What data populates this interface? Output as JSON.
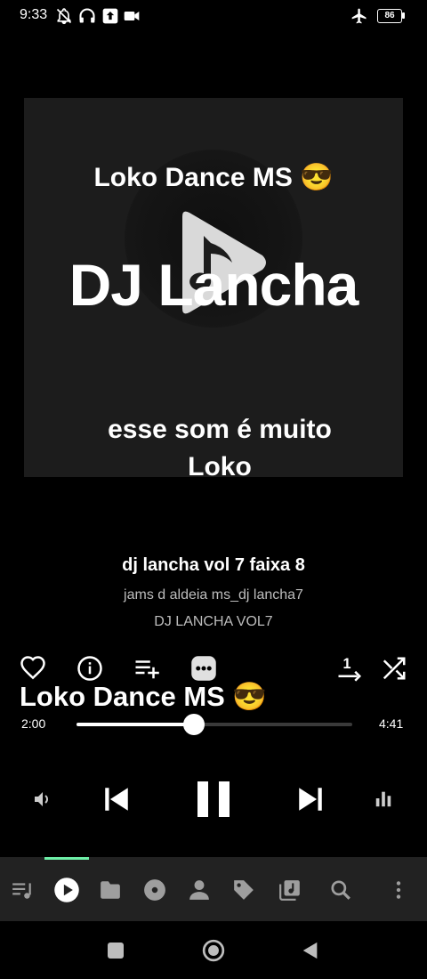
{
  "status_bar": {
    "time": "9:33",
    "battery": "86"
  },
  "artwork": {
    "title_line": "Loko Dance MS 😎",
    "big_text": "DJ Lancha",
    "sub_line": "esse som é muito Loko"
  },
  "track": {
    "title": "dj lancha vol 7 faixa 8",
    "artist": "jams d aldeia ms_dj lancha7",
    "album": "DJ LANCHA VOL7"
  },
  "overlay_title": "Loko Dance MS 😎",
  "playback": {
    "elapsed": "2:00",
    "total": "4:41",
    "progress": 0.427
  },
  "colors": {
    "accent": "#6ef0a8",
    "nav_bg": "#222222"
  },
  "nav_items": [
    "queue-icon",
    "now-playing-icon",
    "folder-icon",
    "album-icon",
    "artist-icon",
    "tag-icon",
    "playlist-icon",
    "search-icon",
    "more-vert-icon"
  ]
}
